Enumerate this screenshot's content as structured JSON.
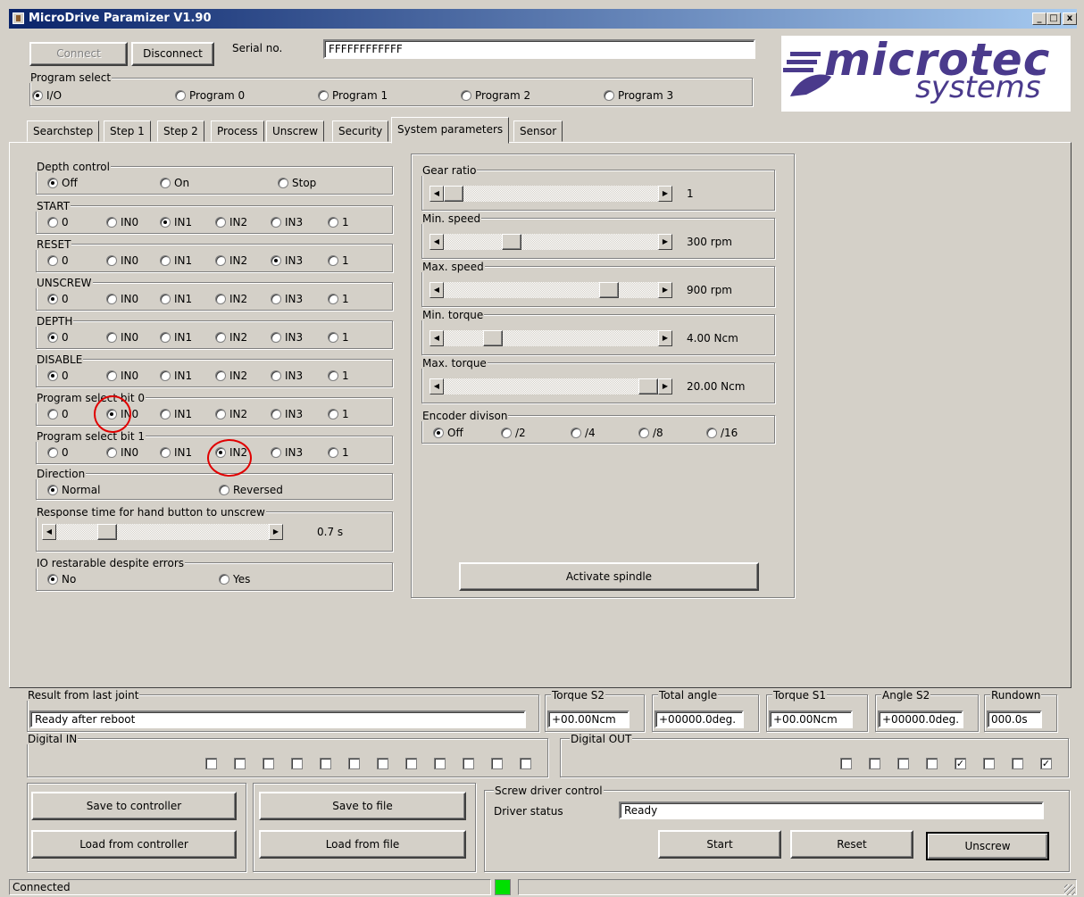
{
  "window": {
    "title": "MicroDrive Paramizer V1.90",
    "min_label": "_",
    "max_label": "□",
    "close_label": "x"
  },
  "conn": {
    "connect": "Connect",
    "disconnect": "Disconnect",
    "serial_label": "Serial no.",
    "serial_value": "FFFFFFFFFFFF"
  },
  "logo": {
    "top": "microtec",
    "bottom": "systems",
    "color": "#4a3a8c"
  },
  "program_select": {
    "label": "Program select",
    "options": [
      "I/O",
      "Program 0",
      "Program 1",
      "Program 2",
      "Program 3"
    ],
    "selected": 0
  },
  "tabs": [
    "Searchstep",
    "Step 1",
    "Step 2",
    "Process",
    "Unscrew",
    "Security",
    "System parameters",
    "Sensor"
  ],
  "active_tab": 6,
  "depth_control": {
    "label": "Depth control",
    "options": [
      "Off",
      "On",
      "Stop"
    ],
    "selected": 0
  },
  "io_groups": [
    {
      "label": "START",
      "selected": 2
    },
    {
      "label": "RESET",
      "selected": 4
    },
    {
      "label": "UNSCREW",
      "selected": 0
    },
    {
      "label": "DEPTH",
      "selected": 0
    },
    {
      "label": "DISABLE",
      "selected": 0
    },
    {
      "label": "Program select bit 0",
      "selected": 1
    },
    {
      "label": "Program select bit 1",
      "selected": 3
    }
  ],
  "io_options": [
    "0",
    "IN0",
    "IN1",
    "IN2",
    "IN3",
    "1"
  ],
  "direction": {
    "label": "Direction",
    "options": [
      "Normal",
      "Reversed"
    ],
    "selected": 0
  },
  "response_time": {
    "label": "Response time for hand button to unscrew",
    "value": "0.7 s",
    "position": 0.25
  },
  "io_restart": {
    "label": "IO restarable despite errors",
    "options": [
      "No",
      "Yes"
    ],
    "selected": 0
  },
  "sliders": [
    {
      "label": "Gear ratio",
      "value": "1",
      "position": 0.0
    },
    {
      "label": "Min. speed",
      "value": "300 rpm",
      "position": 0.3
    },
    {
      "label": "Max. speed",
      "value": "900 rpm",
      "position": 0.8
    },
    {
      "label": "Min. torque",
      "value": "4.00 Ncm",
      "position": 0.2
    },
    {
      "label": "Max. torque",
      "value": "20.00 Ncm",
      "position": 1.0
    }
  ],
  "encoder": {
    "label": "Encoder divison",
    "options": [
      "Off",
      "/2",
      "/4",
      "/8",
      "/16"
    ],
    "selected": 0
  },
  "activate_spindle": "Activate spindle",
  "results": {
    "last_joint_label": "Result from last joint",
    "last_joint_value": "Ready after reboot",
    "cols": [
      {
        "label": "Torque S2",
        "value": "+00.00Ncm"
      },
      {
        "label": "Total angle",
        "value": "+00000.0deg."
      },
      {
        "label": "Torque S1",
        "value": "+00.00Ncm"
      },
      {
        "label": "Angle S2",
        "value": "+00000.0deg."
      },
      {
        "label": "Rundown",
        "value": "000.0s"
      }
    ]
  },
  "digital_in": {
    "label": "Digital IN",
    "states": [
      false,
      false,
      false,
      false,
      false,
      false,
      false,
      false,
      false,
      false,
      false,
      false
    ]
  },
  "digital_out": {
    "label": "Digital OUT",
    "states": [
      false,
      false,
      false,
      false,
      true,
      false,
      false,
      true
    ]
  },
  "buttons": {
    "save_controller": "Save to controller",
    "load_controller": "Load from controller",
    "save_file": "Save to file",
    "load_file": "Load from file"
  },
  "driver": {
    "label": "Screw driver control",
    "status_label": "Driver status",
    "status_value": "Ready",
    "start": "Start",
    "reset": "Reset",
    "unscrew": "Unscrew"
  },
  "statusbar": {
    "text": "Connected",
    "indicator_color": "#00e000"
  }
}
